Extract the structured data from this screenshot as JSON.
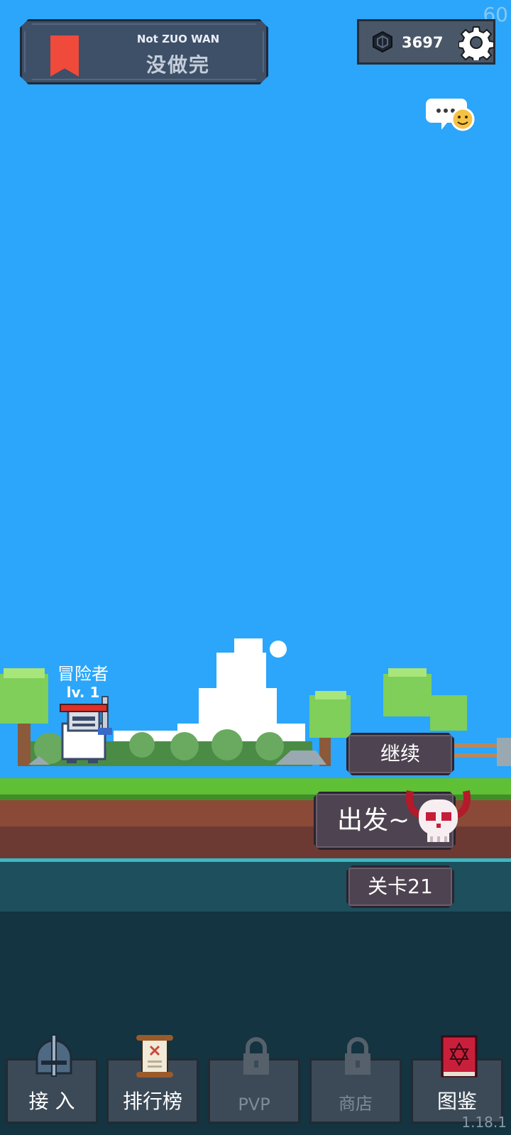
{
  "hud": {
    "fps": "60",
    "banner": {
      "subtitle": "Not ZUO WAN",
      "title": "没做完"
    },
    "currency_value": "3697",
    "version": "1.18.1"
  },
  "hero": {
    "name": "冒险者",
    "level": "lv. 1",
    "hp_fraction": 1.0
  },
  "actions": {
    "continue_label": "继续",
    "go_label": "出发~",
    "level_label": "关卡21"
  },
  "nav": [
    {
      "label": "接 入",
      "icon": "knight-helmet-icon",
      "enabled": true
    },
    {
      "label": "排行榜",
      "icon": "scroll-icon",
      "enabled": true
    },
    {
      "label": "PVP",
      "icon": "lock-icon",
      "enabled": false
    },
    {
      "label": "商店",
      "icon": "lock-icon",
      "enabled": false
    },
    {
      "label": "图鉴",
      "icon": "spellbook-icon",
      "enabled": true
    }
  ],
  "colors": {
    "sky": "#2ba6fa",
    "grass": "#5fbf35",
    "dirt": "#8b4a37",
    "hp": "#e0302a",
    "bookmark": "#f04a3b"
  }
}
